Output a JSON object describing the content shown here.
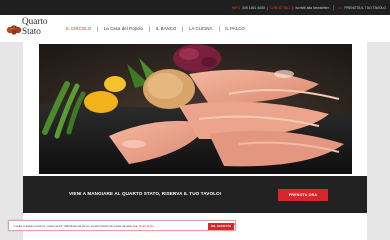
{
  "topbar": {
    "phone_prefix": "INFO",
    "phone": "345 1461 4400",
    "contact_link": "CONTATTACI",
    "newsletter": "Iscriviti alla Newsletter",
    "reserve_prefix": "☏",
    "reserve": "PRENOTA IL TUO TAVOLO"
  },
  "logo": {
    "line1": "Quarto",
    "line2": "Stato"
  },
  "nav": {
    "items": [
      {
        "label": "IL CIRCOLO",
        "active": true
      },
      {
        "label": "La Casa del Popolo",
        "active": false
      },
      {
        "label": "IL BANCO",
        "active": false
      },
      {
        "label": "LA CUCINA",
        "active": false
      },
      {
        "label": "IL PALCO",
        "active": false
      }
    ]
  },
  "cta": {
    "text": "VIENI A MANGIARE AL QUARTO STATO, RISERVA IL TUO TAVOLO!",
    "button": "PRENOTA ORA"
  },
  "footer": {
    "faint_text": "CHI SIAMO"
  },
  "cookie": {
    "text": "I cookie ci aiutano a fornire i nostri servizi. Utilizzando tali servizi, accetti l'utilizzo dei cookie da parte mia.",
    "more": "Scopri di più",
    "button": "OK, ACCETTO",
    "close": "×"
  },
  "colors": {
    "accent": "#d8272c",
    "topbar": "#1f1f1f",
    "cta_band": "#222222"
  }
}
